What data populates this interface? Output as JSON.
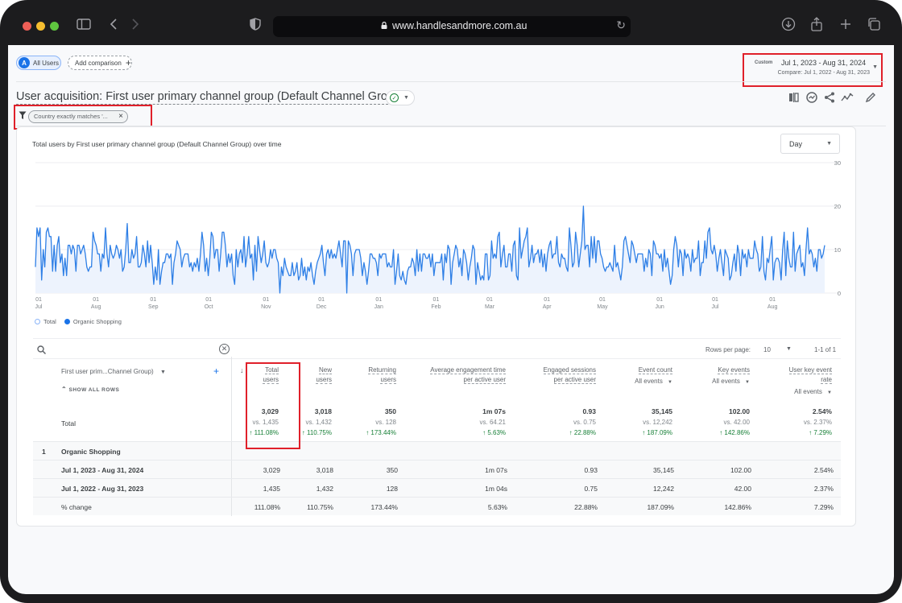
{
  "browser": {
    "url": "www.handlesandmore.com.au",
    "icons": [
      "sidebar-icon",
      "back-icon",
      "forward-icon",
      "shield-icon",
      "lock-icon",
      "reload-icon",
      "download-icon",
      "share-icon",
      "new-tab-icon",
      "tabs-icon"
    ]
  },
  "segments": {
    "all_users_avatar": "A",
    "all_users_label": "All Users",
    "add_comparison_label": "Add comparison",
    "add_icon": "+"
  },
  "date_range": {
    "custom_label": "Custom",
    "main": "Jul 1, 2023 - Aug 31, 2024",
    "compare": "Compare: Jul 1, 2022 - Aug 31, 2023"
  },
  "report": {
    "title": "User acquisition: First user primary channel group (Default Channel Group)",
    "toolbar_icons": [
      "compare-columns-icon",
      "insights-icon",
      "share-icon",
      "trend-icon",
      "edit-icon"
    ]
  },
  "filter": {
    "chip_label": "Country exactly matches '...",
    "remove_icon": "×"
  },
  "chart_data": {
    "type": "area",
    "title": "Total users by First user primary channel group (Default Channel Group) over time",
    "granularity": "Day",
    "xlabel": "",
    "ylabel": "",
    "ylim": [
      0,
      30
    ],
    "yticks": [
      "30",
      "20",
      "10",
      "0"
    ],
    "grid": true,
    "x_range": [
      "2023-07-01",
      "2024-08-31"
    ],
    "xticks": [
      {
        "day": "01",
        "month": "Jul"
      },
      {
        "day": "01",
        "month": "Aug"
      },
      {
        "day": "01",
        "month": "Sep"
      },
      {
        "day": "01",
        "month": "Oct"
      },
      {
        "day": "01",
        "month": "Nov"
      },
      {
        "day": "01",
        "month": "Dec"
      },
      {
        "day": "01",
        "month": "Jan"
      },
      {
        "day": "01",
        "month": "Feb"
      },
      {
        "day": "01",
        "month": "Mar"
      },
      {
        "day": "01",
        "month": "Apr"
      },
      {
        "day": "01",
        "month": "May"
      },
      {
        "day": "01",
        "month": "Jun"
      },
      {
        "day": "01",
        "month": "Jul"
      },
      {
        "day": "01",
        "month": "Aug"
      }
    ],
    "legend": [
      "Total",
      "Organic Shopping"
    ],
    "legend_position": "bottom-left",
    "series": [
      {
        "name": "Organic Shopping",
        "color": "#1a73e8",
        "values": [
          6,
          15,
          13,
          15,
          3,
          10,
          6,
          14,
          15,
          13,
          13,
          5,
          11,
          5,
          11,
          13,
          7,
          9,
          4,
          8,
          4,
          11,
          11,
          9,
          11,
          10,
          5,
          11,
          11,
          9,
          10,
          11,
          9,
          6,
          5,
          6,
          6,
          14,
          12,
          11,
          9,
          9,
          5,
          9,
          8,
          15,
          9,
          6,
          11,
          9,
          8,
          9,
          11,
          10,
          8,
          10,
          5,
          6,
          10,
          16,
          7,
          7,
          10,
          8,
          9,
          13,
          6,
          6,
          7,
          11,
          9,
          6,
          12,
          7,
          11,
          7,
          2,
          6,
          3,
          10,
          2,
          5,
          7,
          7,
          9,
          9,
          8,
          9,
          2,
          7,
          9,
          12,
          11,
          10,
          6,
          8,
          9,
          9,
          9,
          6,
          7,
          5,
          7,
          6,
          8,
          5,
          9,
          14,
          11,
          5,
          8,
          4,
          8,
          14,
          13,
          8,
          10,
          10,
          5,
          9,
          14,
          14,
          11,
          6,
          9,
          7,
          9,
          4,
          2,
          10,
          6,
          9,
          10,
          7,
          13,
          6,
          9,
          13,
          8,
          9,
          3,
          11,
          5,
          13,
          10,
          7,
          9,
          12,
          7,
          6,
          7,
          10,
          8,
          10,
          10,
          8,
          7,
          0,
          6,
          4,
          8,
          6,
          5,
          4,
          4,
          7,
          4,
          5,
          7,
          3,
          4,
          8,
          4,
          6,
          3,
          6,
          5,
          7,
          4,
          2,
          5,
          7,
          8,
          9,
          11,
          7,
          4,
          9,
          10,
          8,
          10,
          8,
          9,
          8,
          10,
          12,
          9,
          6,
          12,
          12,
          0,
          12,
          11,
          9,
          4,
          9,
          10,
          10,
          10,
          8,
          4,
          7,
          5,
          2,
          5,
          9,
          9,
          8,
          8,
          7,
          4,
          9,
          8,
          9,
          9,
          9,
          6,
          7,
          6,
          6,
          10,
          2,
          5,
          9,
          4,
          3,
          5,
          3,
          2,
          5,
          6,
          6,
          8,
          7,
          4,
          10,
          5,
          9,
          5,
          9,
          9,
          8,
          8,
          9,
          6,
          9,
          4,
          7,
          7,
          7,
          7,
          9,
          3,
          9,
          7,
          11,
          10,
          2,
          7,
          9,
          11,
          10,
          6,
          8,
          4,
          10,
          9,
          7,
          3,
          6,
          8,
          11,
          10,
          2,
          7,
          5,
          3,
          4,
          3,
          9,
          9,
          3,
          4,
          12,
          8,
          9,
          8,
          13,
          14,
          6,
          9,
          11,
          6,
          6,
          9,
          9,
          5,
          11,
          12,
          4,
          3,
          15,
          8,
          10,
          12,
          13,
          15,
          6,
          8,
          11,
          7,
          9,
          9,
          10,
          7,
          10,
          6,
          9,
          5,
          9,
          11,
          12,
          8,
          9,
          9,
          13,
          7,
          6,
          9,
          8,
          8,
          6,
          5,
          15,
          11,
          6,
          7,
          14,
          11,
          6,
          9,
          12,
          20,
          10,
          11,
          11,
          6,
          13,
          8,
          13,
          7,
          12,
          12,
          9,
          8,
          6,
          5,
          6,
          6,
          7,
          6,
          5,
          11,
          6,
          7,
          5,
          3,
          6,
          12,
          13,
          11,
          9,
          7,
          12,
          11,
          9,
          7,
          9,
          9,
          9,
          9,
          5,
          8,
          6,
          10,
          9,
          4,
          12,
          11,
          9,
          9,
          8,
          9,
          5,
          10,
          6,
          8,
          5,
          2,
          4,
          10,
          13,
          11,
          6,
          10,
          9,
          4,
          10,
          8,
          9,
          8,
          5,
          10,
          7,
          8,
          8,
          12,
          4,
          7,
          7,
          12,
          8,
          14,
          15,
          10,
          9,
          11,
          9,
          5,
          8,
          10,
          7,
          4,
          10,
          9,
          8,
          3,
          4,
          7,
          9,
          5,
          11,
          9,
          4,
          10,
          8,
          9,
          6,
          10,
          8,
          8,
          8,
          12,
          10,
          9,
          5,
          6,
          13,
          5,
          3,
          8,
          7,
          10,
          13,
          3,
          7,
          8,
          8,
          7,
          3,
          10,
          14,
          4,
          12,
          8,
          6,
          6,
          14,
          5,
          9,
          10,
          11,
          6,
          7,
          4,
          10,
          15,
          9,
          10,
          9,
          6,
          8,
          5,
          10,
          10,
          8,
          9,
          11
        ]
      }
    ]
  },
  "table": {
    "search_placeholder": "",
    "rows_per_page_label": "Rows per page:",
    "rows_per_page_value": "10",
    "pagination": "1-1 of 1",
    "dimension_header": "First user prim...Channel Group)",
    "show_all_rows": "SHOW ALL ROWS",
    "add_dimension_icon": "+",
    "sort_icon": "↓",
    "columns": [
      {
        "line1": "Total",
        "line2": "users",
        "sub": ""
      },
      {
        "line1": "New",
        "line2": "users",
        "sub": ""
      },
      {
        "line1": "Returning",
        "line2": "users",
        "sub": ""
      },
      {
        "line1": "Average engagement time",
        "line2": "per active user",
        "sub": ""
      },
      {
        "line1": "Engaged sessions",
        "line2": "per active user",
        "sub": ""
      },
      {
        "line1": "Event count",
        "line2": "",
        "sub": "All events"
      },
      {
        "line1": "Key events",
        "line2": "",
        "sub": "All events"
      },
      {
        "line1": "User key event",
        "line2": "rate",
        "sub": "All events"
      }
    ],
    "totals": {
      "label": "Total",
      "values": [
        "3,029",
        "3,018",
        "350",
        "1m 07s",
        "0.93",
        "35,145",
        "102.00",
        "2.54%"
      ],
      "vs": [
        "vs. 1,435",
        "vs. 1,432",
        "vs. 128",
        "vs. 64.21",
        "vs. 0.75",
        "vs. 12,242",
        "vs. 42.00",
        "vs. 2.37%"
      ],
      "change": [
        "↑ 111.08%",
        "↑ 110.75%",
        "↑ 173.44%",
        "↑ 5.63%",
        "↑ 22.88%",
        "↑ 187.09%",
        "↑ 142.86%",
        "↑ 7.29%"
      ]
    },
    "rows": [
      {
        "index": "1",
        "name": "Organic Shopping",
        "values": [
          "",
          "",
          "",
          "",
          "",
          "",
          "",
          ""
        ]
      },
      {
        "index": "",
        "name": "Jul 1, 2023 - Aug 31, 2024",
        "values": [
          "3,029",
          "3,018",
          "350",
          "1m 07s",
          "0.93",
          "35,145",
          "102.00",
          "2.54%"
        ]
      },
      {
        "index": "",
        "name": "Jul 1, 2022 - Aug 31, 2023",
        "values": [
          "1,435",
          "1,432",
          "128",
          "1m 04s",
          "0.75",
          "12,242",
          "42.00",
          "2.37%"
        ]
      },
      {
        "index": "",
        "name": "% change",
        "values": [
          "111.08%",
          "110.75%",
          "173.44%",
          "5.63%",
          "22.88%",
          "187.09%",
          "142.86%",
          "7.29%"
        ]
      }
    ]
  }
}
